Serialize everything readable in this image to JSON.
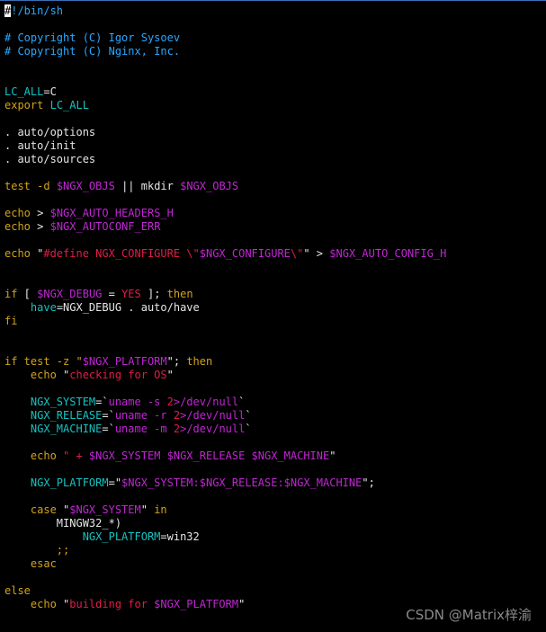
{
  "colors": {
    "background": "#000000",
    "default": "#e6e6e6",
    "comment": "#2aa7ff",
    "keyword": "#d2a31a",
    "variable": "#c026d3",
    "string": "#e11d48",
    "assign": "#17c2c2",
    "cursor_bg": "#ffffff",
    "border": "#3a6fb5"
  },
  "watermark": "CSDN @Matrix梓渝",
  "lines": [
    [
      {
        "t": "#",
        "c": "cursor"
      },
      {
        "t": "!/bin/sh",
        "c": "comment"
      }
    ],
    [],
    [
      {
        "t": "# Copyright (C) Igor Sysoev",
        "c": "comment"
      }
    ],
    [
      {
        "t": "# Copyright (C) Nginx, Inc.",
        "c": "comment"
      }
    ],
    [],
    [],
    [
      {
        "t": "LC_ALL",
        "c": "assign"
      },
      {
        "t": "=C",
        "c": "default"
      }
    ],
    [
      {
        "t": "export",
        "c": "keyword"
      },
      {
        "t": " ",
        "c": "default"
      },
      {
        "t": "LC_ALL",
        "c": "assign"
      }
    ],
    [],
    [
      {
        "t": ". auto/options",
        "c": "default"
      }
    ],
    [
      {
        "t": ". auto/init",
        "c": "default"
      }
    ],
    [
      {
        "t": ". auto/sources",
        "c": "default"
      }
    ],
    [],
    [
      {
        "t": "test",
        "c": "keyword"
      },
      {
        "t": " -d ",
        "c": "keyword"
      },
      {
        "t": "$NGX_OBJS",
        "c": "variable"
      },
      {
        "t": " || mkdir ",
        "c": "default"
      },
      {
        "t": "$NGX_OBJS",
        "c": "variable"
      }
    ],
    [],
    [
      {
        "t": "echo",
        "c": "keyword"
      },
      {
        "t": " > ",
        "c": "default"
      },
      {
        "t": "$NGX_AUTO_HEADERS_H",
        "c": "variable"
      }
    ],
    [
      {
        "t": "echo",
        "c": "keyword"
      },
      {
        "t": " > ",
        "c": "default"
      },
      {
        "t": "$NGX_AUTOCONF_ERR",
        "c": "variable"
      }
    ],
    [],
    [
      {
        "t": "echo",
        "c": "keyword"
      },
      {
        "t": " \"",
        "c": "default"
      },
      {
        "t": "#define NGX_CONFIGURE \\\"",
        "c": "string"
      },
      {
        "t": "$NGX_CONFIGURE",
        "c": "variable"
      },
      {
        "t": "\\\"",
        "c": "string"
      },
      {
        "t": "\" > ",
        "c": "default"
      },
      {
        "t": "$NGX_AUTO_CONFIG_H",
        "c": "variable"
      }
    ],
    [],
    [],
    [
      {
        "t": "if",
        "c": "keyword"
      },
      {
        "t": " [ ",
        "c": "default"
      },
      {
        "t": "$NGX_DEBUG",
        "c": "variable"
      },
      {
        "t": " = ",
        "c": "default"
      },
      {
        "t": "YES",
        "c": "string"
      },
      {
        "t": " ]; ",
        "c": "default"
      },
      {
        "t": "then",
        "c": "keyword"
      }
    ],
    [
      {
        "t": "    ",
        "c": "default"
      },
      {
        "t": "have",
        "c": "assign"
      },
      {
        "t": "=NGX_DEBUG . auto/have",
        "c": "default"
      }
    ],
    [
      {
        "t": "fi",
        "c": "keyword"
      }
    ],
    [],
    [],
    [
      {
        "t": "if",
        "c": "keyword"
      },
      {
        "t": " test -z \"",
        "c": "keyword"
      },
      {
        "t": "$NGX_PLATFORM",
        "c": "variable"
      },
      {
        "t": "\"; ",
        "c": "default"
      },
      {
        "t": "then",
        "c": "keyword"
      }
    ],
    [
      {
        "t": "    echo",
        "c": "keyword"
      },
      {
        "t": " \"",
        "c": "default"
      },
      {
        "t": "checking for OS",
        "c": "string"
      },
      {
        "t": "\"",
        "c": "default"
      }
    ],
    [],
    [
      {
        "t": "    NGX_SYSTEM",
        "c": "assign"
      },
      {
        "t": "=`",
        "c": "default"
      },
      {
        "t": "uname -s ",
        "c": "variable"
      },
      {
        "t": "2",
        "c": "string"
      },
      {
        "t": ">/dev/null",
        "c": "variable"
      },
      {
        "t": "`",
        "c": "default"
      }
    ],
    [
      {
        "t": "    NGX_RELEASE",
        "c": "assign"
      },
      {
        "t": "=`",
        "c": "default"
      },
      {
        "t": "uname -r ",
        "c": "variable"
      },
      {
        "t": "2",
        "c": "string"
      },
      {
        "t": ">/dev/null",
        "c": "variable"
      },
      {
        "t": "`",
        "c": "default"
      }
    ],
    [
      {
        "t": "    NGX_MACHINE",
        "c": "assign"
      },
      {
        "t": "=`",
        "c": "default"
      },
      {
        "t": "uname -m ",
        "c": "variable"
      },
      {
        "t": "2",
        "c": "string"
      },
      {
        "t": ">/dev/null",
        "c": "variable"
      },
      {
        "t": "`",
        "c": "default"
      }
    ],
    [],
    [
      {
        "t": "    echo",
        "c": "keyword"
      },
      {
        "t": " \" + ",
        "c": "string"
      },
      {
        "t": "$NGX_SYSTEM $NGX_RELEASE $NGX_MACHINE",
        "c": "variable"
      },
      {
        "t": "\"",
        "c": "default"
      }
    ],
    [],
    [
      {
        "t": "    NGX_PLATFORM",
        "c": "assign"
      },
      {
        "t": "=\"",
        "c": "default"
      },
      {
        "t": "$NGX_SYSTEM:$NGX_RELEASE:$NGX_MACHINE",
        "c": "variable"
      },
      {
        "t": "\";",
        "c": "default"
      }
    ],
    [],
    [
      {
        "t": "    case",
        "c": "keyword"
      },
      {
        "t": " \"",
        "c": "default"
      },
      {
        "t": "$NGX_SYSTEM",
        "c": "variable"
      },
      {
        "t": "\" ",
        "c": "default"
      },
      {
        "t": "in",
        "c": "keyword"
      }
    ],
    [
      {
        "t": "        MINGW32_*)",
        "c": "default"
      }
    ],
    [
      {
        "t": "            NGX_PLATFORM",
        "c": "assign"
      },
      {
        "t": "=win32",
        "c": "default"
      }
    ],
    [
      {
        "t": "        ;;",
        "c": "keyword"
      }
    ],
    [
      {
        "t": "    esac",
        "c": "keyword"
      }
    ],
    [],
    [
      {
        "t": "else",
        "c": "keyword"
      }
    ],
    [
      {
        "t": "    echo",
        "c": "keyword"
      },
      {
        "t": " \"",
        "c": "default"
      },
      {
        "t": "building for ",
        "c": "string"
      },
      {
        "t": "$NGX_PLATFORM",
        "c": "variable"
      },
      {
        "t": "\"",
        "c": "default"
      }
    ]
  ]
}
